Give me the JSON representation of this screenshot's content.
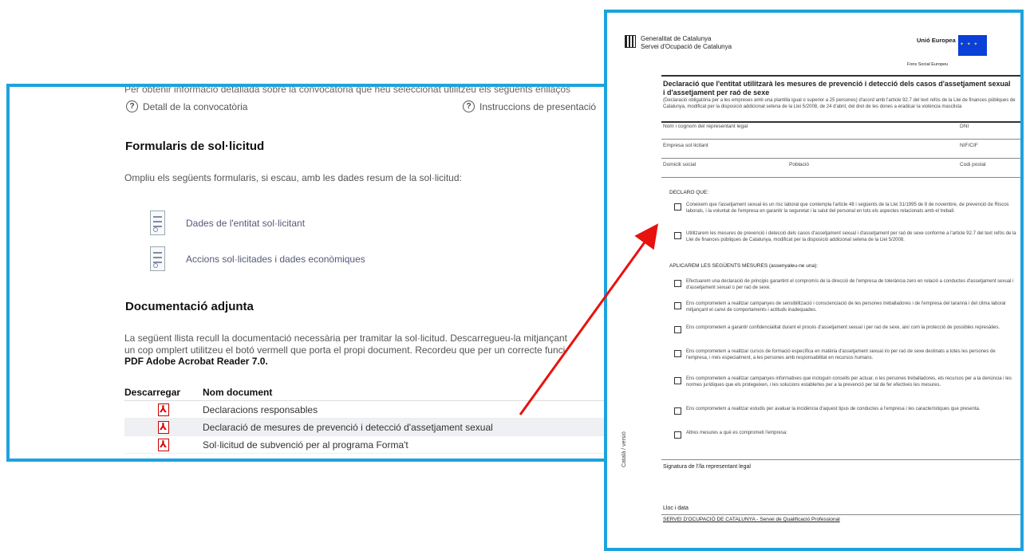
{
  "left": {
    "intro_text": "Per obtenir informació detallada sobre la convocatòria que heu seleccionat utilitzeu els següents enllaços",
    "help_links": [
      {
        "label": "Detall de la convocatòria"
      },
      {
        "label": "Instruccions de presentació"
      }
    ],
    "forms_section": {
      "title": "Formularis de sol·licitud",
      "description": "Ompliu els següents formularis, si escau, amb les dades resum de la sol·licitud:",
      "forms": [
        {
          "label": "Dades de l'entitat sol·licitant"
        },
        {
          "label": "Accions sol·licitades i dades econòmiques"
        }
      ]
    },
    "docs_section": {
      "title": "Documentació adjunta",
      "line1": "La següent llista recull la documentació necessària per tramitar la sol·licitud. Descarregueu-la mitjançant",
      "line2": "un cop omplert utilitzeu el botó vermell que porta el propi document. Recordeu que per un correcte funci",
      "reader_note": "PDF Adobe Acrobat Reader 7.0.",
      "table": {
        "col_download": "Descarregar",
        "col_name": "Nom document",
        "rows": [
          {
            "name": "Declaracions responsables"
          },
          {
            "name": "Declaració de mesures de prevenció i detecció d'assetjament sexual"
          },
          {
            "name": "Sol·licitud de subvenció per al programa Forma't"
          }
        ]
      }
    }
  },
  "right": {
    "org_line1": "Generalitat de Catalunya",
    "org_line2": "Servei d'Ocupació de Catalunya",
    "eu_title": "Unió Europea",
    "eu_sub": "Fons Social Europeu",
    "decl_title": "Declaració que l'entitat utilitzarà les mesures de prevenció i detecció dels casos d'assetjament sexual i d'assetjament per raó de sexe",
    "decl_subtitle": "(Declaració obligatòria per a les empreses amb una plantilla igual o superior a 25 persones) d'acord amb l'article 92.7 del text refós de la Llei de finances públiques de Catalunya, modificat per la disposició addicional setena de la Llei 5/2008, de 24 d'abril, del dret de les dones a eradicar la violència masclista",
    "fields": [
      {
        "left": "Nom i cognom del representant legal",
        "right": "DNI"
      },
      {
        "left": "Empresa sol·licitant",
        "right": "NIF/CIF"
      },
      {
        "left": "Domicili social",
        "mid": "Població",
        "right": "Codi postal"
      }
    ],
    "declaro": "DECLARO QUE:",
    "checks_a": [
      "Coneixem que l'assetjament sexual és un risc laboral que contempla l'article 48 i següents de la Llei 31/1995 de 8 de novembre, de prevenció de Riscos laborals, i la voluntat de l'empresa en garantir la seguretat i la salut del personal en tots els aspectes relacionats amb el treball.",
      "Utilitzarem les mesures de prevenció i detecció dels casos d'assetjament sexual i d'assetjament per raó de sexe conforme a l'article 92.7 del text refós de la Llei de finances públiques de Catalunya, modificat per la disposició addicional setena de la Llei 5/2008."
    ],
    "aplicarem": "APLICAREM LES SEGÜENTS MESURES (assenyaleu-ne una):",
    "checks_b": [
      "Efectuarem una declaració de principis garantint el compromís de la direcció de l'empresa de tolerància zero en relació a conductes d'assetjament sexual i d'assetjament sexual o per raó de sexe.",
      "Ens comprometem a realitzar campanyes de sensibilització i conscienciació de les persones treballadores i de l'empresa del tarannà i del clima laboral mitjançant el canvi de comportaments i actituds inadequades.",
      "Ens comprometem a garantir confidencialitat durant el procés d'assetjament sexual i per raó de sexe, així com la protecció de possibles represàlies.",
      "Ens comprometem a realitzar cursos de formació específica en matèria d'assetjament sexual i/o per raó de sexe destinats a totes les persones de l'empresa, i més especialment, a les persones amb responsabilitat en recursos humans.",
      "Ens comprometem a realitzar campanyes informatives que incloguin consells per actuar, o les persones treballadores, els recursos per a la denúncia i les normes jurídiques que els protegeixen, i les solucions establertes per a la prevenció per tal de fer efectives les mesures.",
      "Ens comprometem a realitzar estudis per avaluar la incidència d'aquest tipus de conductes a l'empresa i les característiques que presenta.",
      "Altres mesures a què es comprometi l'empresa:"
    ],
    "signature": "Signatura de l'/la representant legal",
    "place_date": "Lloc i data",
    "footer": "SERVEI D'OCUPACIÓ DE CATALUNYA - Servei de Qualificació Professional",
    "side_label": "Català / versió"
  },
  "colors": {
    "frame": "#1da3dc",
    "arrow": "#e8120e",
    "pdf_red": "#d00000"
  }
}
